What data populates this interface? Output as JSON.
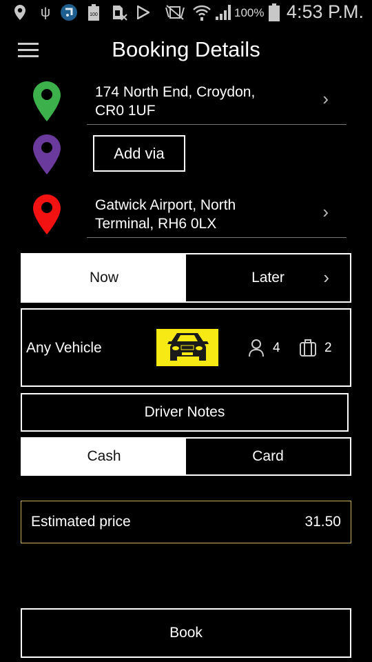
{
  "status_bar": {
    "icons": [
      "location-icon",
      "usb-icon",
      "app-notification-icon",
      "battery-100-icon",
      "sim-card-x-icon",
      "play-store-icon",
      "vibrate-off-icon",
      "wifi-icon",
      "signal-icon"
    ],
    "battery_percent": "100%",
    "time": "4:53 P.M."
  },
  "header": {
    "title": "Booking Details",
    "menu_icon": "hamburger-menu-icon"
  },
  "route": {
    "pickup": {
      "address_line1": "174 North End, Croydon,",
      "address_line2": "CR0 1UF",
      "pin_color": "#3cb04a"
    },
    "via": {
      "button_label": "Add via",
      "pin_color": "#6a3a9c"
    },
    "dropoff": {
      "address_line1": "Gatwick Airport, North",
      "address_line2": "Terminal, RH6 0LX",
      "pin_color": "#f21212"
    }
  },
  "timing": {
    "options": [
      "Now",
      "Later"
    ],
    "selected": "Now"
  },
  "vehicle": {
    "label": "Any Vehicle",
    "image_bg": "#f7ea14",
    "passengers": "4",
    "luggage": "2"
  },
  "driver_notes_label": "Driver Notes",
  "payment": {
    "options": [
      "Cash",
      "Card"
    ],
    "selected": "Cash"
  },
  "price": {
    "label": "Estimated price",
    "value": "31.50",
    "border_color": "#c9b25a"
  },
  "book_label": "Book"
}
